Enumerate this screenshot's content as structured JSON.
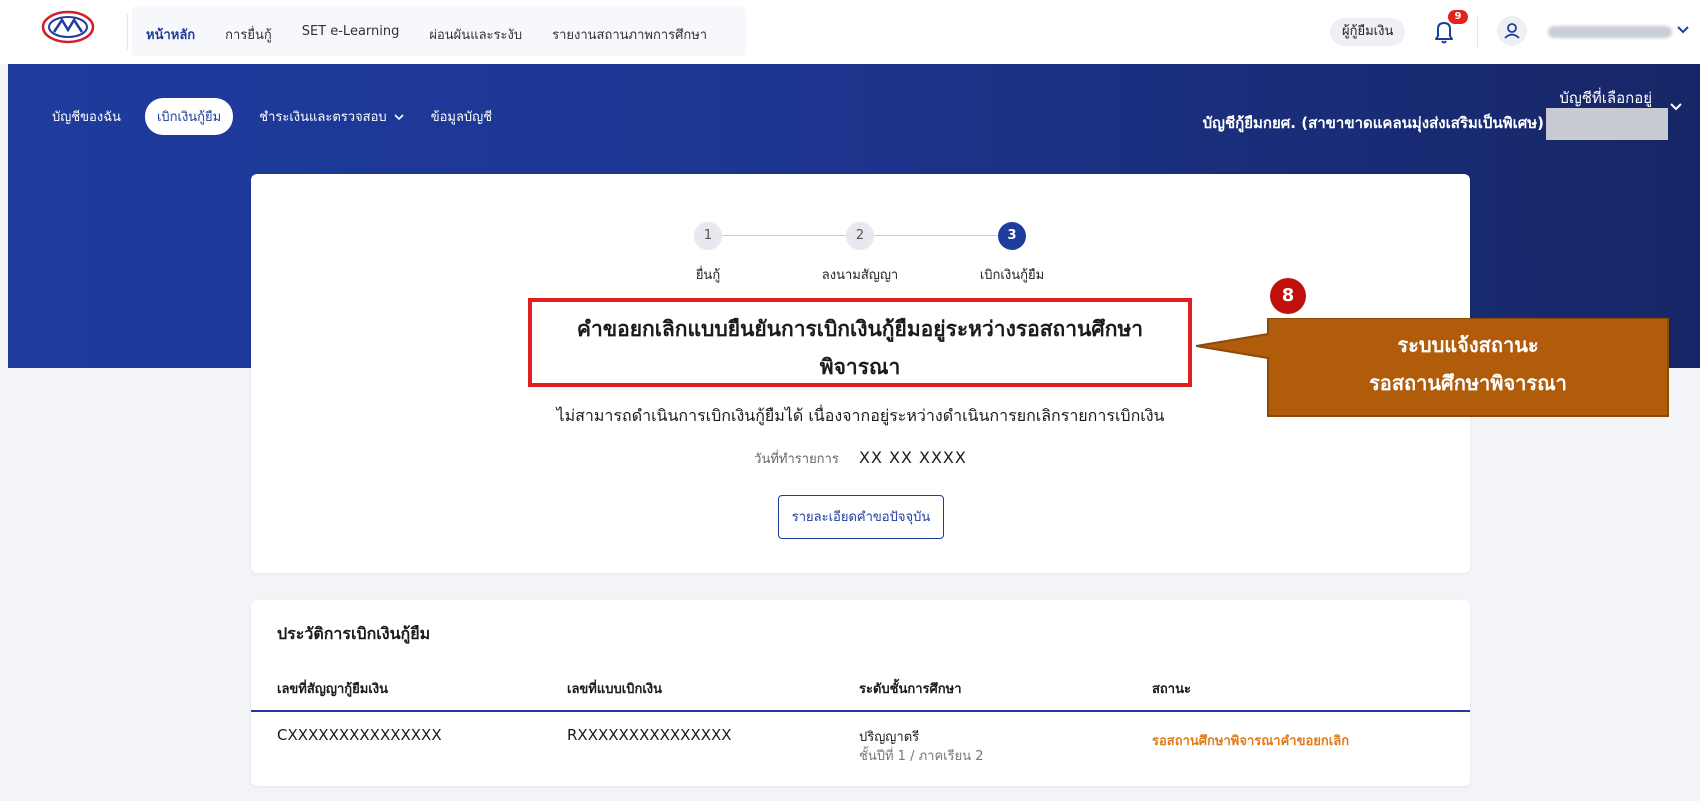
{
  "topnav": {
    "items": [
      "หน้าหลัก",
      "การยื่นกู้",
      "SET e-Learning",
      "ผ่อนผันและระงับ",
      "รายงานสถานภาพการศึกษา"
    ],
    "active_index": 0
  },
  "top_right": {
    "borrower_label": "ผู้กู้ยืมเงิน",
    "notification_count": "9"
  },
  "subnav": {
    "items": [
      "บัญชีของฉัน",
      "เบิกเงินกู้ยืม",
      "ชำระเงินและตรวจสอบ",
      "ข้อมูลบัญชี"
    ],
    "active_index": 1
  },
  "account": {
    "selected_label": "บัญชีที่เลือกอยู่",
    "name": "บัญชีกู้ยืมกยศ. (สาขาขาดแคลนมุ่งส่งเสริมเป็นพิเศษ)"
  },
  "stepper": {
    "steps": [
      {
        "num": "1",
        "label": "ยื่นกู้"
      },
      {
        "num": "2",
        "label": "ลงนามสัญญา"
      },
      {
        "num": "3",
        "label": "เบิกเงินกู้ยืม"
      }
    ],
    "active_index": 2
  },
  "status": {
    "title_line1": "คำขอยกเลิกแบบยืนยันการเบิกเงินกู้ยืมอยู่ระหว่างรอสถานศึกษา",
    "title_line2": "พิจารณา",
    "description": "ไม่สามารถดำเนินการเบิกเงินกู้ยืมได้ เนื่องจากอยู่ระหว่างดำเนินการยกเลิกรายการเบิกเงิน",
    "date_label": "วันที่ทำรายการ",
    "date_value": "XX XX XXXX",
    "detail_button": "รายละเอียดคำขอปัจจุบัน"
  },
  "callout": {
    "number": "8",
    "line1": "ระบบแจ้งสถานะ",
    "line2": "รอสถานศึกษาพิจารณา",
    "fill_color": "#b15c0a",
    "border_color": "#8c4a08"
  },
  "history": {
    "title": "ประวัติการเบิกเงินกู้ยืม",
    "columns": [
      "เลขที่สัญญากู้ยืมเงิน",
      "เลขที่แบบเบิกเงิน",
      "ระดับชั้นการศึกษา",
      "สถานะ"
    ],
    "row": {
      "contract_no": "CXXXXXXXXXXXXXXX",
      "form_no": "RXXXXXXXXXXXXXXX",
      "edu_level": "ปริญญาตรี",
      "edu_detail": "ชั้นปีที่ 1 / ภาคเรียน 2",
      "status": "รอสถานศึกษาพิจารณาคำขอยกเลิก"
    }
  },
  "colors": {
    "primary": "#1f3d9c",
    "highlight_border": "#e01f1f",
    "status_orange": "#e07c1a"
  }
}
